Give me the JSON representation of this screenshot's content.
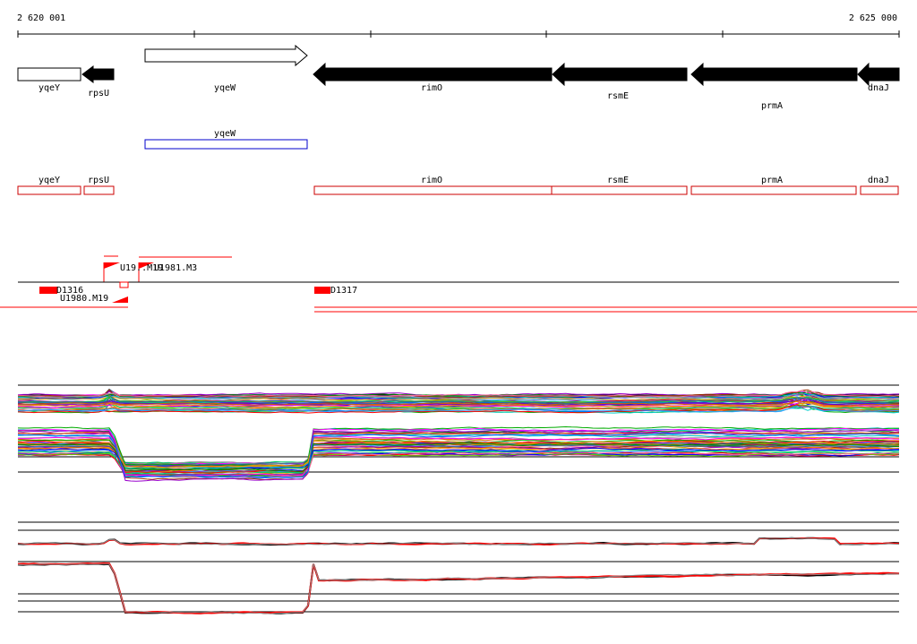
{
  "ruler": {
    "start_label": "2 620 001",
    "end_label": "2 625 000"
  },
  "annotated_genes": [
    {
      "name": "yqeY",
      "strand": "forward",
      "style": "outline"
    },
    {
      "name": "rpsU",
      "strand": "reverse",
      "style": "filled"
    },
    {
      "name": "yqeW",
      "strand": "forward",
      "style": "outline"
    },
    {
      "name": "rimO",
      "strand": "reverse",
      "style": "filled"
    },
    {
      "name": "rsmE",
      "strand": "reverse",
      "style": "filled"
    },
    {
      "name": "prmA",
      "strand": "reverse",
      "style": "filled"
    },
    {
      "name": "dnaJ",
      "strand": "reverse",
      "style": "filled"
    }
  ],
  "blue_track": [
    {
      "name": "yqeW"
    }
  ],
  "red_track": [
    {
      "name": "yqeY"
    },
    {
      "name": "rpsU"
    },
    {
      "name": "rimO"
    },
    {
      "name": "rsmE"
    },
    {
      "name": "prmA"
    },
    {
      "name": "dnaJ"
    }
  ],
  "segments": [
    {
      "label": "U19..M19"
    },
    {
      "label": "U1981.M3"
    },
    {
      "label": "D1316"
    },
    {
      "label": "U1980.M19"
    },
    {
      "label": "D1317"
    }
  ],
  "colors": {
    "gene_fill": "#000000",
    "blue_box": "#0000cc",
    "red_box": "#cc0000",
    "segment": "#ff0000",
    "summary_red": "#ff0000",
    "summary_black": "#000000"
  }
}
